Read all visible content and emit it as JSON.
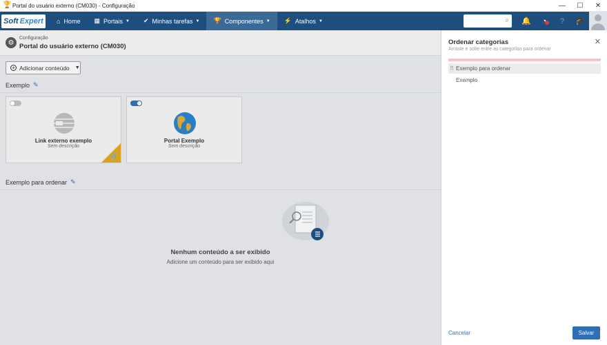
{
  "window": {
    "title": "Portal do usuário externo (CM030) - Configuração",
    "controls": [
      "—",
      "☐",
      "✕"
    ]
  },
  "navbar": {
    "logo_part1": "Soft",
    "logo_part2": "Expert",
    "items": [
      {
        "label": "Home",
        "icon": "home-icon"
      },
      {
        "label": "Portais",
        "icon": "grid-icon"
      },
      {
        "label": "Minhas tarefas",
        "icon": "check-icon"
      },
      {
        "label": "Componentes",
        "icon": "trophy-icon"
      },
      {
        "label": "Atalhos",
        "icon": "bolt-icon"
      }
    ],
    "search_placeholder": ""
  },
  "page": {
    "breadcrumb": "Configuração",
    "title": "Portal do usuário externo (CM030)",
    "add_button": "Adicionar conteúdo"
  },
  "sections": [
    {
      "title": "Exemplo",
      "cards": [
        {
          "title": "Link externo exemplo",
          "desc": "Sem descrição",
          "enabled": false
        },
        {
          "title": "Portal Exemplo",
          "desc": "Sem descrição",
          "enabled": true
        }
      ]
    },
    {
      "title": "Exemplo para ordenar",
      "empty_title": "Nenhum conteúdo a ser exibido",
      "empty_sub": "Adicione um conteúdo para ser exibido aqui"
    }
  ],
  "panel": {
    "title": "Ordenar categorias",
    "subtitle": "Arraste e solte entre as categorias para ordenar",
    "items": [
      "Exemplo para ordenar",
      "Exemplo"
    ],
    "cancel": "Cancelar",
    "save": "Salvar"
  },
  "colors": {
    "nav": "#1e4e7d",
    "accent": "#2f6db5",
    "corner": "#d9a21b"
  }
}
